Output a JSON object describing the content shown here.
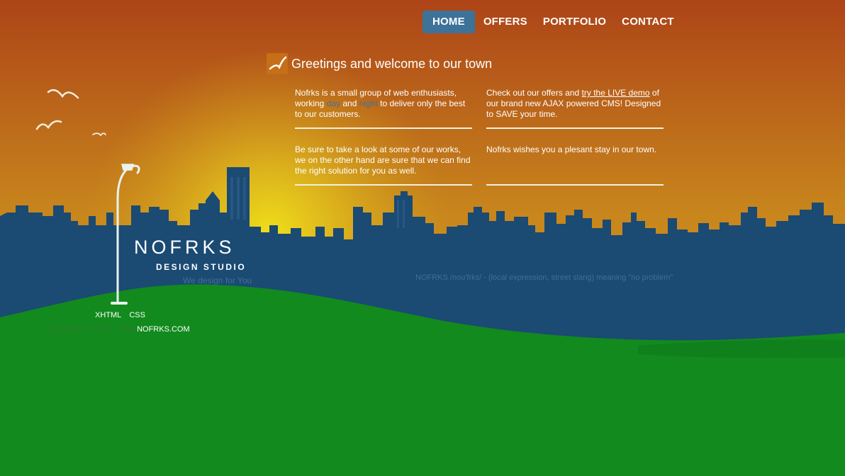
{
  "nav": {
    "items": [
      {
        "label": "HOME",
        "active": true
      },
      {
        "label": "OFFERS",
        "active": false
      },
      {
        "label": "PORTFOLIO",
        "active": false
      },
      {
        "label": "CONTACT",
        "active": false
      }
    ]
  },
  "main": {
    "heading": "Greetings and welcome to our town",
    "box1": {
      "text_a": "Nofrks is a small group of web enthusiasts, working ",
      "word_day": "day",
      "text_b": " and ",
      "word_night": "night",
      "text_c": " to deliver only the best to our customers."
    },
    "box2": {
      "text_a": "Check out our offers and ",
      "link": "try the LIVE demo",
      "text_b": " of our brand new AJAX powered CMS! Designed to SAVE your time."
    },
    "box3": {
      "text": "Be sure to take a look at some of our works, we on the other hand are sure that we can find the right solution for you as well."
    },
    "box4": {
      "text": "Nofrks wishes you a plesant stay in our town."
    }
  },
  "logo": {
    "name": "NOFRKS",
    "subtitle": "DESIGN STUDIO",
    "tagline": "We design for You"
  },
  "meaning": "NOFRKS /nou'frks/ - (local expression, street slang) meaning \"no problem\"",
  "footer": {
    "badges": [
      "XHTML",
      "CSS"
    ],
    "copyright": "Copyright © 2007 - 2008 ",
    "site": "NOFRKS.COM"
  },
  "colors": {
    "sky_top": "#b0461c",
    "sky_glow": "#e2d11a",
    "city": "#1b4a73",
    "grass": "#128a1e",
    "nav_active": "#3d7299"
  }
}
